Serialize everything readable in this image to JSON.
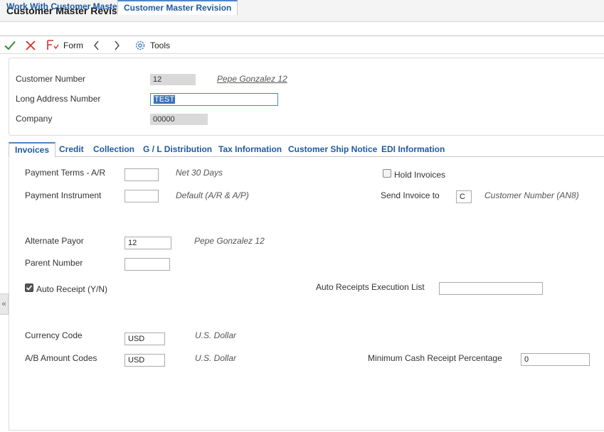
{
  "app": {
    "title": "Customer Master Revision"
  },
  "breadcrumb": {
    "items": [
      "Work With Customer Master",
      "Customer Master Revision"
    ]
  },
  "toolbar": {
    "form_label": "Form",
    "tools_label": "Tools"
  },
  "header": {
    "customer_number_label": "Customer Number",
    "customer_number_value": "12",
    "customer_name": "Pepe Gonzalez 12",
    "long_address_label": "Long Address Number",
    "long_address_value": "TEST",
    "company_label": "Company",
    "company_value": "00000"
  },
  "tabs": [
    "Invoices",
    "Credit",
    "Collection",
    "G / L Distribution",
    "Tax Information",
    "Customer Ship Notice",
    "EDI Information"
  ],
  "invoices": {
    "payment_terms_label": "Payment Terms - A/R",
    "payment_terms_value": "",
    "payment_terms_desc": "Net 30 Days",
    "hold_invoices_label": "Hold Invoices",
    "hold_invoices_checked": false,
    "payment_instrument_label": "Payment Instrument",
    "payment_instrument_value": "",
    "payment_instrument_desc": "Default (A/R & A/P)",
    "send_invoice_label": "Send Invoice to",
    "send_invoice_value": "C",
    "send_invoice_desc": "Customer Number (AN8)",
    "alternate_payor_label": "Alternate Payor",
    "alternate_payor_value": "12",
    "alternate_payor_desc": "Pepe Gonzalez 12",
    "parent_number_label": "Parent Number",
    "parent_number_value": "",
    "auto_receipt_label": "Auto Receipt (Y/N)",
    "auto_receipt_checked": true,
    "auto_receipts_list_label": "Auto Receipts Execution List",
    "auto_receipts_list_value": "",
    "currency_code_label": "Currency Code",
    "currency_code_value": "USD",
    "currency_code_desc": "U.S. Dollar",
    "ab_amount_label": "A/B Amount Codes",
    "ab_amount_value": "USD",
    "ab_amount_desc": "U.S. Dollar",
    "min_cash_label": "Minimum Cash Receipt Percentage",
    "min_cash_value": "0"
  },
  "colors": {
    "link": "#1e5aa3",
    "accent": "#4b87c6",
    "ok_check": "#2e8b3a",
    "cancel_x": "#d0322a"
  }
}
